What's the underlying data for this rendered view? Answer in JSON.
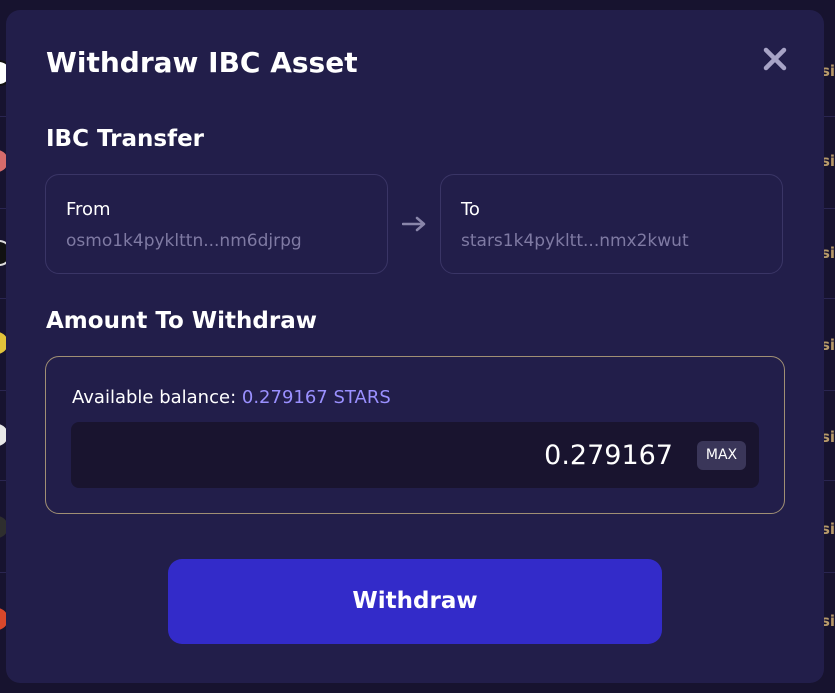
{
  "modal": {
    "title": "Withdraw IBC Asset",
    "close_icon": "close-icon"
  },
  "transfer": {
    "section_title": "IBC Transfer",
    "from": {
      "label": "From",
      "address": "osmo1k4pyklttn...nm6djrpg"
    },
    "to": {
      "label": "To",
      "address": "stars1k4pykltt...nmx2kwut"
    },
    "arrow_icon": "arrow-right-icon"
  },
  "amount": {
    "section_title": "Amount To Withdraw",
    "balance_label": "Available balance:",
    "balance_value": "0.279167 STARS",
    "input_value": "0.279167",
    "max_label": "MAX"
  },
  "actions": {
    "withdraw_label": "Withdraw"
  },
  "background": {
    "cut_text": "si"
  },
  "colors": {
    "modal_bg": "#221e4a",
    "accent_button": "#332bc9",
    "balance_highlight": "#9a90ff",
    "amount_border": "#a08f74"
  }
}
